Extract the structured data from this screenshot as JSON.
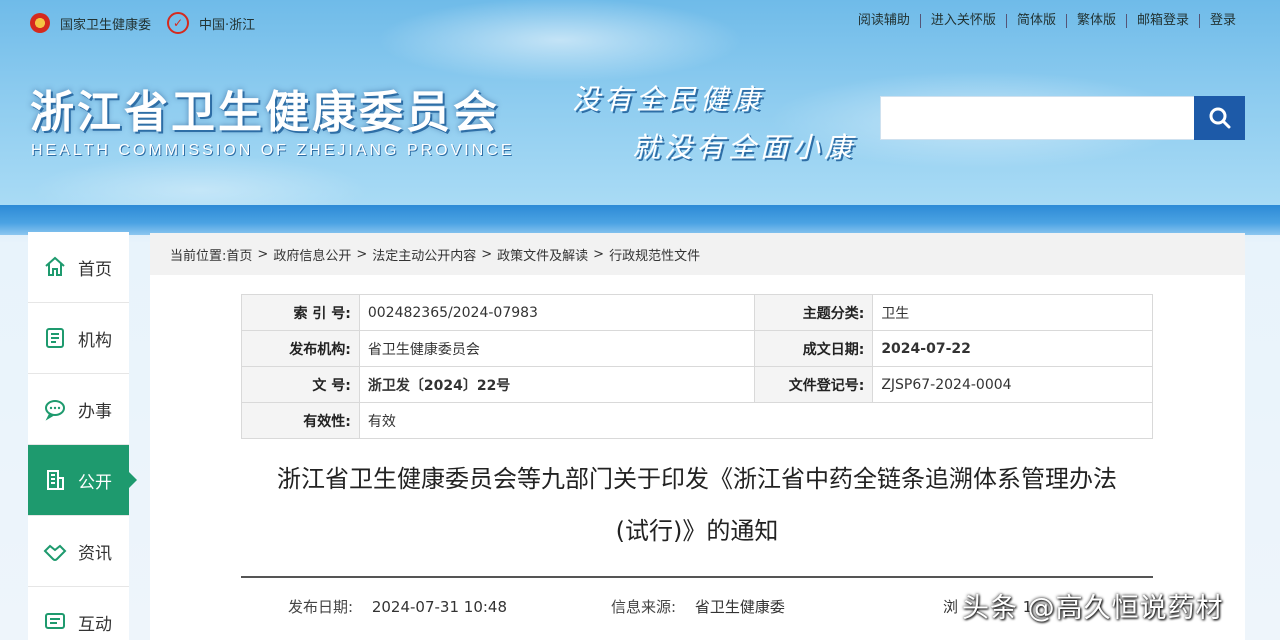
{
  "top_bar": {
    "left_links": [
      {
        "icon": "national-emblem-icon",
        "label": "国家卫生健康委"
      },
      {
        "icon": "china-zhejiang-icon",
        "label": "中国·浙江"
      }
    ],
    "right_links": [
      "阅读辅助",
      "进入关怀版",
      "简体版",
      "繁体版",
      "邮箱登录",
      "登录"
    ]
  },
  "header": {
    "title": "浙江省卫生健康委员会",
    "subtitle": "HEALTH COMMISSION OF ZHEJIANG PROVINCE",
    "slogan_line1": "没有全民健康",
    "slogan_line2": "就没有全面小康"
  },
  "search": {
    "placeholder": "",
    "button_icon": "search-icon"
  },
  "sidenav": {
    "items": [
      {
        "label": "首页",
        "icon": "home-icon",
        "active": false
      },
      {
        "label": "机构",
        "icon": "document-icon",
        "active": false
      },
      {
        "label": "办事",
        "icon": "chat-icon",
        "active": false
      },
      {
        "label": "公开",
        "icon": "building-icon",
        "active": true
      },
      {
        "label": "资讯",
        "icon": "handshake-icon",
        "active": false
      },
      {
        "label": "互动",
        "icon": "message-icon",
        "active": false
      }
    ],
    "active_color": "#1e9a6e"
  },
  "breadcrumb": {
    "prefix": "当前位置:",
    "items": [
      "首页",
      "政府信息公开",
      "法定主动公开内容",
      "政策文件及解读",
      "行政规范性文件"
    ]
  },
  "meta_table": {
    "rows": [
      {
        "k1": "索 引 号:",
        "v1": "002482365/2024-07983",
        "k2": "主题分类:",
        "v2": "卫生"
      },
      {
        "k1": "发布机构:",
        "v1": "省卫生健康委员会",
        "k2": "成文日期:",
        "v2": "2024-07-22"
      },
      {
        "k1": "文 号:",
        "v1": "浙卫发〔2024〕22号",
        "k2": "文件登记号:",
        "v2": "ZJSP67-2024-0004"
      },
      {
        "k1": "有效性:",
        "v1": "有效"
      }
    ]
  },
  "document": {
    "title_line1": "浙江省卫生健康委员会等九部门关于印发《浙江省中药全链条追溯体系管理办法",
    "title_line2": "(试行)》的通知",
    "publish_label": "发布日期:",
    "publish_date": "2024-07-31 10:48",
    "source_label": "信息来源:",
    "source_value": "省卫生健康委",
    "views_label": "浏",
    "views_value": "1"
  },
  "watermark": "头条 @高久恒说药材",
  "colors": {
    "brand_blue": "#1d5aa8",
    "nav_green": "#1e9a6e"
  }
}
